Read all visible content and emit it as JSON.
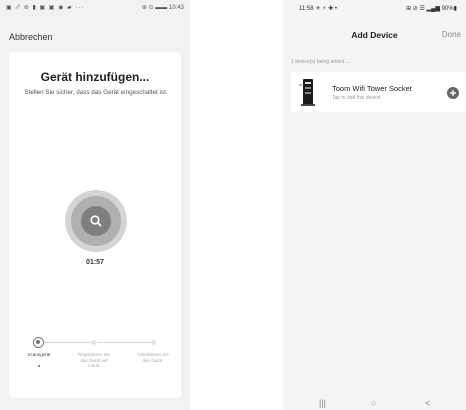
{
  "left_screen": {
    "status_bar": {
      "left_icons": "▣ ␥ ⊜ ▮ ▣ ▣ ◉ ▰ ···",
      "right_text": "⊛ ⊙ ▬▬ 10:43"
    },
    "cancel_label": "Abbrechen",
    "title": "Gerät hinzufügen...",
    "subtitle": "Stellen Sie sicher, dass das Gerät eingeschaltet ist.",
    "scan_icon": "search-icon",
    "timer": "01:57",
    "steps": [
      {
        "label": "Scanngerät",
        "state": "active"
      },
      {
        "label": "Registrieren Sie das Gerät auf Cloud.",
        "state": "pending"
      },
      {
        "label": "Initialisieren Sie das Gerät.",
        "state": "pending"
      }
    ]
  },
  "right_screen": {
    "status_bar": {
      "time": "11:58 ☀ ⚡ ✚ •",
      "right_text": "⊞ ⊘ ☰ ▂▄▆ 90%▮"
    },
    "header": {
      "title": "Add Device",
      "done_label": "Done"
    },
    "being_added_text": "1 device(s) being added ...",
    "device": {
      "name": "Toom Wifi Tower Socket",
      "hint": "Tap to add this device",
      "add_icon": "plus-circle-icon"
    },
    "nav": {
      "recents": "|||",
      "home": "○",
      "back": "<"
    }
  },
  "colors": {
    "background": "#ffffff",
    "left_bg": "#f2f2f2",
    "card_bg": "#ffffff",
    "accent_gray": "#7f7f7f"
  }
}
